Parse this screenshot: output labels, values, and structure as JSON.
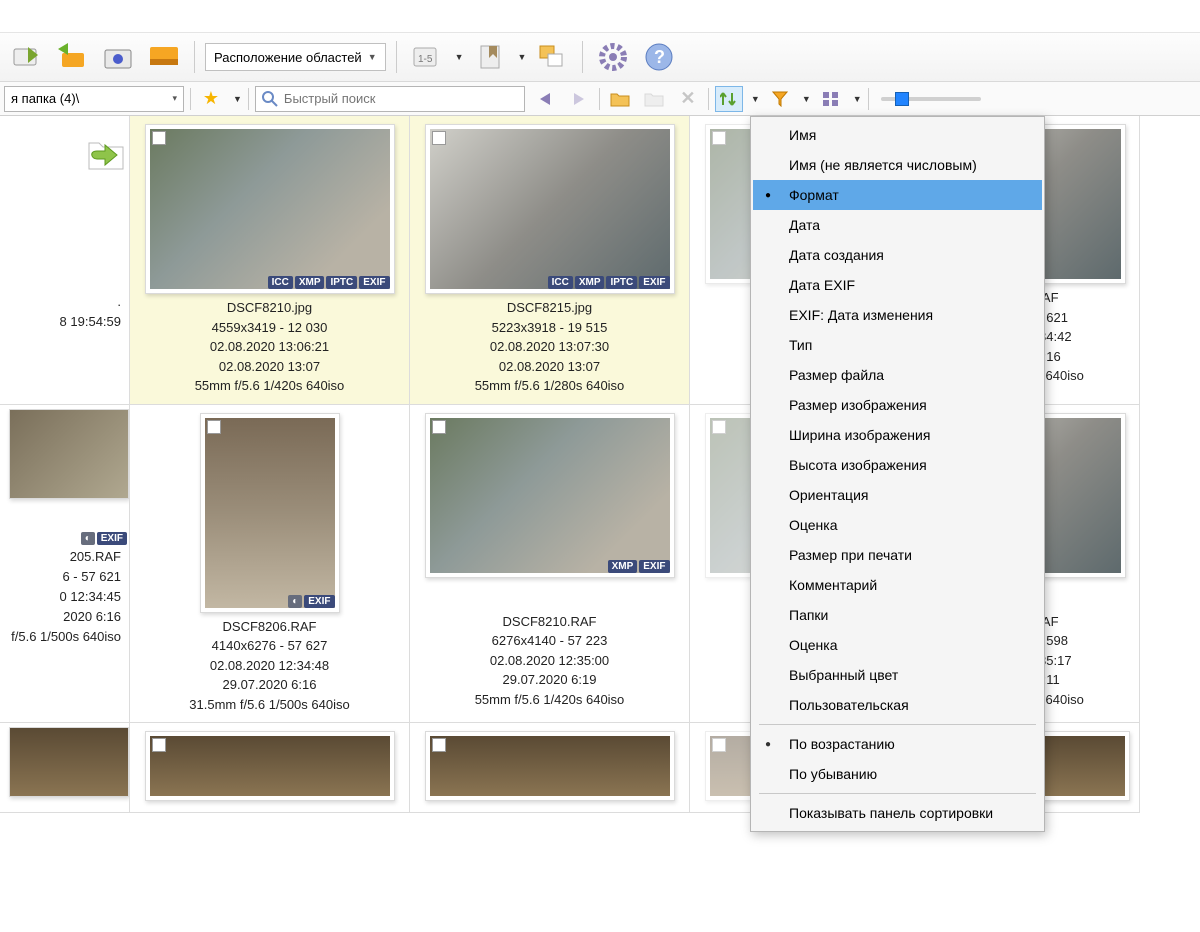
{
  "toolbar": {
    "layout_label": "Расположение областей"
  },
  "addressbar": {
    "path": "я папка (4)\\",
    "search_placeholder": "Быстрый поиск"
  },
  "sort_menu": {
    "items": [
      {
        "label": "Имя"
      },
      {
        "label": "Имя (не является числовым)"
      },
      {
        "label": "Формат",
        "selected": true,
        "checked": true
      },
      {
        "label": "Дата"
      },
      {
        "label": "Дата создания"
      },
      {
        "label": "Дата EXIF"
      },
      {
        "label": "EXIF: Дата изменения"
      },
      {
        "label": "Тип"
      },
      {
        "label": "Размер файла"
      },
      {
        "label": "Размер изображения"
      },
      {
        "label": "Ширина изображения"
      },
      {
        "label": "Высота изображения"
      },
      {
        "label": "Ориентация"
      },
      {
        "label": "Оценка"
      },
      {
        "label": "Размер при печати"
      },
      {
        "label": "Комментарий"
      },
      {
        "label": "Папки"
      },
      {
        "label": "Оценка"
      },
      {
        "label": "Выбранный цвет"
      },
      {
        "label": "Пользовательская"
      }
    ],
    "order": [
      {
        "label": "По возрастанию",
        "checked": true
      },
      {
        "label": "По убыванию"
      }
    ],
    "footer": {
      "label": "Показывать панель сортировки"
    }
  },
  "left_partial": {
    "row1": {
      "line1": ".",
      "line2": "8 19:54:59"
    },
    "row2": {
      "name": "205.RAF",
      "dims": "6 - 57 621",
      "date1": "0 12:34:45",
      "date2": "2020 6:16",
      "exif": "f/5.6 1/500s 640iso"
    }
  },
  "thumbs": {
    "r1c1": {
      "name": "DSCF8210.jpg",
      "dims": "4559x3419 - 12 030",
      "date1": "02.08.2020 13:06:21",
      "date2": "02.08.2020 13:07",
      "exif": "55mm f/5.6 1/420s 640iso",
      "badges": [
        "ICC",
        "XMP",
        "IPTC",
        "EXIF"
      ]
    },
    "r1c2": {
      "name": "DSCF8215.jpg",
      "dims": "5223x3918 - 19 515",
      "date1": "02.08.2020 13:07:30",
      "date2": "02.08.2020 13:07",
      "exif": "55mm f/5.6 1/280s 640iso",
      "badges": [
        "ICC",
        "XMP",
        "IPTC",
        "EXIF"
      ]
    },
    "r1c5": {
      "name": "SCF8204.RAF",
      "dims": "0x6276 - 57 621",
      "date1": ".8.2020 12:34:42",
      "date2": "1.07.2020 6:16",
      "exif": "f/5.6 1/500s 640iso"
    },
    "r2c1": {
      "name": "DSCF8206.RAF",
      "dims": "4140x6276 - 57 627",
      "date1": "02.08.2020 12:34:48",
      "date2": "29.07.2020 6:16",
      "exif": "31.5mm f/5.6 1/500s 640iso",
      "badges": [
        "EXIF"
      ]
    },
    "r2c2": {
      "name": "DSCF8210.RAF",
      "dims": "6276x4140 - 57 223",
      "date1": "02.08.2020 12:35:00",
      "date2": "29.07.2020 6:19",
      "exif": "55mm f/5.6 1/420s 640iso",
      "badges": [
        "XMP",
        "EXIF"
      ]
    },
    "r2c5": {
      "name": "SCF8216.RAF",
      "dims": "6x4140 - 56 598",
      "date1": ".8.2020 12:35:17",
      "date2": "1.07.2020 6:11",
      "exif": "f/5.6 1/220s 640iso"
    }
  }
}
